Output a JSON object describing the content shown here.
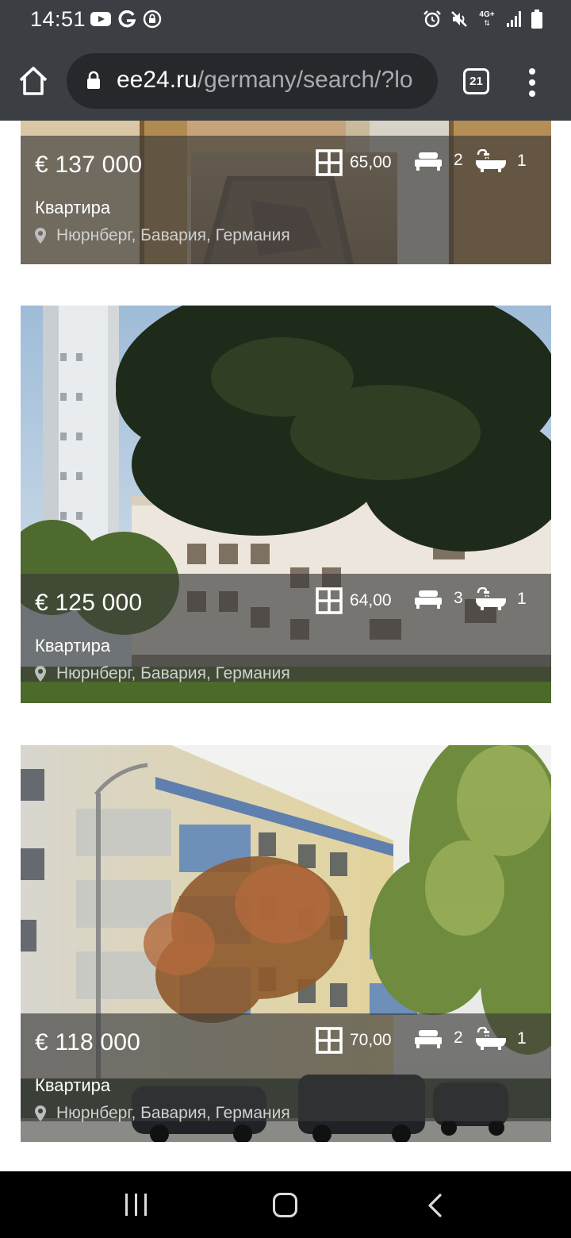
{
  "status_bar": {
    "time": "14:51",
    "network_label": "4G+",
    "left_icons": [
      "youtube-icon",
      "google-icon",
      "vpn-lock-icon"
    ],
    "right_icons": [
      "alarm-icon",
      "mute-icon",
      "network-icon",
      "signal-icon",
      "battery-icon"
    ]
  },
  "browser": {
    "url_host": "ee24.ru",
    "url_path": "/germany/search/?lo",
    "tab_count": "21",
    "icons": [
      "home-icon",
      "lock-icon",
      "tab-switcher-icon",
      "more-menu-icon"
    ]
  },
  "listings": [
    {
      "price": "€ 137 000",
      "type": "Квартира",
      "location": "Нюрнберг, Бавария, Германия",
      "area": "65,00",
      "bedrooms": "2",
      "bathrooms": "1"
    },
    {
      "price": "€ 125 000",
      "type": "Квартира",
      "location": "Нюрнберг, Бавария, Германия",
      "area": "64,00",
      "bedrooms": "3",
      "bathrooms": "1"
    },
    {
      "price": "€ 118 000",
      "type": "Квартира",
      "location": "Нюрнберг, Бавария, Германия",
      "area": "70,00",
      "bedrooms": "2",
      "bathrooms": "1"
    }
  ],
  "nav_bar": {
    "buttons": [
      "recent-apps-icon",
      "home-button-icon",
      "back-icon"
    ]
  },
  "colors": {
    "system_bar": "#3b3e43",
    "url_field": "#26282b",
    "overlay": "rgba(58,58,58,0.66)",
    "nav_bar": "#000000"
  }
}
